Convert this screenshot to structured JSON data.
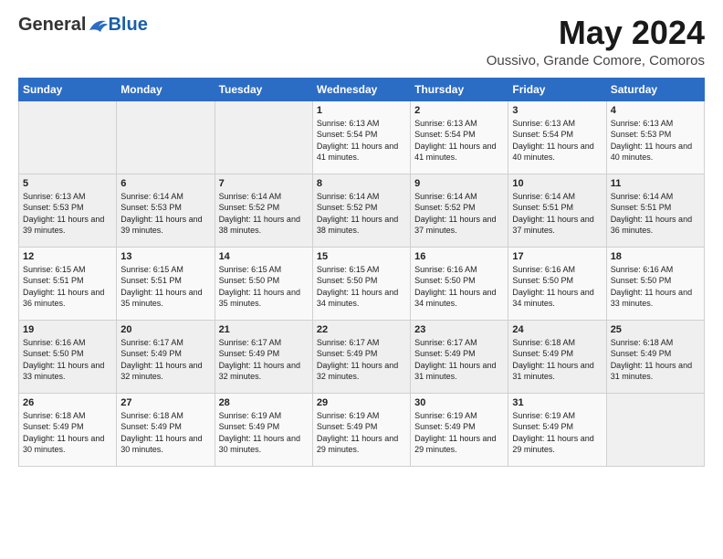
{
  "header": {
    "logo_general": "General",
    "logo_blue": "Blue",
    "month_title": "May 2024",
    "subtitle": "Oussivo, Grande Comore, Comoros"
  },
  "days_of_week": [
    "Sunday",
    "Monday",
    "Tuesday",
    "Wednesday",
    "Thursday",
    "Friday",
    "Saturday"
  ],
  "weeks": [
    [
      {
        "day": "",
        "sunrise": "",
        "sunset": "",
        "daylight": ""
      },
      {
        "day": "",
        "sunrise": "",
        "sunset": "",
        "daylight": ""
      },
      {
        "day": "",
        "sunrise": "",
        "sunset": "",
        "daylight": ""
      },
      {
        "day": "1",
        "sunrise": "Sunrise: 6:13 AM",
        "sunset": "Sunset: 5:54 PM",
        "daylight": "Daylight: 11 hours and 41 minutes."
      },
      {
        "day": "2",
        "sunrise": "Sunrise: 6:13 AM",
        "sunset": "Sunset: 5:54 PM",
        "daylight": "Daylight: 11 hours and 41 minutes."
      },
      {
        "day": "3",
        "sunrise": "Sunrise: 6:13 AM",
        "sunset": "Sunset: 5:54 PM",
        "daylight": "Daylight: 11 hours and 40 minutes."
      },
      {
        "day": "4",
        "sunrise": "Sunrise: 6:13 AM",
        "sunset": "Sunset: 5:53 PM",
        "daylight": "Daylight: 11 hours and 40 minutes."
      }
    ],
    [
      {
        "day": "5",
        "sunrise": "Sunrise: 6:13 AM",
        "sunset": "Sunset: 5:53 PM",
        "daylight": "Daylight: 11 hours and 39 minutes."
      },
      {
        "day": "6",
        "sunrise": "Sunrise: 6:14 AM",
        "sunset": "Sunset: 5:53 PM",
        "daylight": "Daylight: 11 hours and 39 minutes."
      },
      {
        "day": "7",
        "sunrise": "Sunrise: 6:14 AM",
        "sunset": "Sunset: 5:52 PM",
        "daylight": "Daylight: 11 hours and 38 minutes."
      },
      {
        "day": "8",
        "sunrise": "Sunrise: 6:14 AM",
        "sunset": "Sunset: 5:52 PM",
        "daylight": "Daylight: 11 hours and 38 minutes."
      },
      {
        "day": "9",
        "sunrise": "Sunrise: 6:14 AM",
        "sunset": "Sunset: 5:52 PM",
        "daylight": "Daylight: 11 hours and 37 minutes."
      },
      {
        "day": "10",
        "sunrise": "Sunrise: 6:14 AM",
        "sunset": "Sunset: 5:51 PM",
        "daylight": "Daylight: 11 hours and 37 minutes."
      },
      {
        "day": "11",
        "sunrise": "Sunrise: 6:14 AM",
        "sunset": "Sunset: 5:51 PM",
        "daylight": "Daylight: 11 hours and 36 minutes."
      }
    ],
    [
      {
        "day": "12",
        "sunrise": "Sunrise: 6:15 AM",
        "sunset": "Sunset: 5:51 PM",
        "daylight": "Daylight: 11 hours and 36 minutes."
      },
      {
        "day": "13",
        "sunrise": "Sunrise: 6:15 AM",
        "sunset": "Sunset: 5:51 PM",
        "daylight": "Daylight: 11 hours and 35 minutes."
      },
      {
        "day": "14",
        "sunrise": "Sunrise: 6:15 AM",
        "sunset": "Sunset: 5:50 PM",
        "daylight": "Daylight: 11 hours and 35 minutes."
      },
      {
        "day": "15",
        "sunrise": "Sunrise: 6:15 AM",
        "sunset": "Sunset: 5:50 PM",
        "daylight": "Daylight: 11 hours and 34 minutes."
      },
      {
        "day": "16",
        "sunrise": "Sunrise: 6:16 AM",
        "sunset": "Sunset: 5:50 PM",
        "daylight": "Daylight: 11 hours and 34 minutes."
      },
      {
        "day": "17",
        "sunrise": "Sunrise: 6:16 AM",
        "sunset": "Sunset: 5:50 PM",
        "daylight": "Daylight: 11 hours and 34 minutes."
      },
      {
        "day": "18",
        "sunrise": "Sunrise: 6:16 AM",
        "sunset": "Sunset: 5:50 PM",
        "daylight": "Daylight: 11 hours and 33 minutes."
      }
    ],
    [
      {
        "day": "19",
        "sunrise": "Sunrise: 6:16 AM",
        "sunset": "Sunset: 5:50 PM",
        "daylight": "Daylight: 11 hours and 33 minutes."
      },
      {
        "day": "20",
        "sunrise": "Sunrise: 6:17 AM",
        "sunset": "Sunset: 5:49 PM",
        "daylight": "Daylight: 11 hours and 32 minutes."
      },
      {
        "day": "21",
        "sunrise": "Sunrise: 6:17 AM",
        "sunset": "Sunset: 5:49 PM",
        "daylight": "Daylight: 11 hours and 32 minutes."
      },
      {
        "day": "22",
        "sunrise": "Sunrise: 6:17 AM",
        "sunset": "Sunset: 5:49 PM",
        "daylight": "Daylight: 11 hours and 32 minutes."
      },
      {
        "day": "23",
        "sunrise": "Sunrise: 6:17 AM",
        "sunset": "Sunset: 5:49 PM",
        "daylight": "Daylight: 11 hours and 31 minutes."
      },
      {
        "day": "24",
        "sunrise": "Sunrise: 6:18 AM",
        "sunset": "Sunset: 5:49 PM",
        "daylight": "Daylight: 11 hours and 31 minutes."
      },
      {
        "day": "25",
        "sunrise": "Sunrise: 6:18 AM",
        "sunset": "Sunset: 5:49 PM",
        "daylight": "Daylight: 11 hours and 31 minutes."
      }
    ],
    [
      {
        "day": "26",
        "sunrise": "Sunrise: 6:18 AM",
        "sunset": "Sunset: 5:49 PM",
        "daylight": "Daylight: 11 hours and 30 minutes."
      },
      {
        "day": "27",
        "sunrise": "Sunrise: 6:18 AM",
        "sunset": "Sunset: 5:49 PM",
        "daylight": "Daylight: 11 hours and 30 minutes."
      },
      {
        "day": "28",
        "sunrise": "Sunrise: 6:19 AM",
        "sunset": "Sunset: 5:49 PM",
        "daylight": "Daylight: 11 hours and 30 minutes."
      },
      {
        "day": "29",
        "sunrise": "Sunrise: 6:19 AM",
        "sunset": "Sunset: 5:49 PM",
        "daylight": "Daylight: 11 hours and 29 minutes."
      },
      {
        "day": "30",
        "sunrise": "Sunrise: 6:19 AM",
        "sunset": "Sunset: 5:49 PM",
        "daylight": "Daylight: 11 hours and 29 minutes."
      },
      {
        "day": "31",
        "sunrise": "Sunrise: 6:19 AM",
        "sunset": "Sunset: 5:49 PM",
        "daylight": "Daylight: 11 hours and 29 minutes."
      },
      {
        "day": "",
        "sunrise": "",
        "sunset": "",
        "daylight": ""
      }
    ]
  ]
}
